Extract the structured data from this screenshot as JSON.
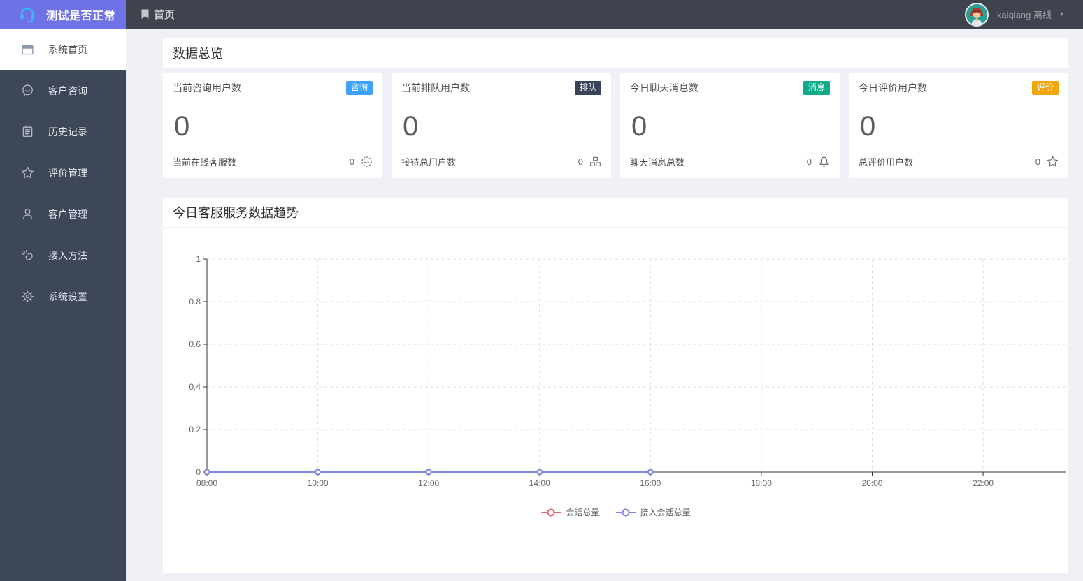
{
  "theme": {
    "logo_bg": "#6f72e6",
    "sidebar_bg": "#3e4757",
    "topbar_bg": "#3e434e",
    "headset_blue": "#3ab5f5"
  },
  "app": {
    "logo_title": "测试是否正常"
  },
  "topbar": {
    "page": "首页",
    "user": "kaiqiang 离线",
    "caret": "▾"
  },
  "sidebar": {
    "items": [
      {
        "label": "系统首页",
        "icon": "window-icon",
        "active": true
      },
      {
        "label": "客户咨询",
        "icon": "chat-smile-icon",
        "active": false
      },
      {
        "label": "历史记录",
        "icon": "history-icon",
        "active": false
      },
      {
        "label": "评价管理",
        "icon": "star-icon",
        "active": false
      },
      {
        "label": "客户管理",
        "icon": "user-icon",
        "active": false
      },
      {
        "label": "接入方法",
        "icon": "link-icon",
        "active": false
      },
      {
        "label": "系统设置",
        "icon": "gear-icon",
        "active": false
      }
    ]
  },
  "overview": {
    "title": "数据总览",
    "cards": [
      {
        "title": "当前咨询用户数",
        "badge": "咨询",
        "badge_color": "#3da2ff",
        "value": "0",
        "footer_label": "当前在线客服数",
        "footer_value": "0",
        "footer_icon": "smiley-icon"
      },
      {
        "title": "当前排队用户数",
        "badge": "排队",
        "badge_color": "#39435a",
        "value": "0",
        "footer_label": "接待总用户数",
        "footer_value": "0",
        "footer_icon": "queue-icon"
      },
      {
        "title": "今日聊天消息数",
        "badge": "消息",
        "badge_color": "#0faa8a",
        "value": "0",
        "footer_label": "聊天消息总数",
        "footer_value": "0",
        "footer_icon": "bell-icon"
      },
      {
        "title": "今日评价用户数",
        "badge": "评价",
        "badge_color": "#f2a60a",
        "value": "0",
        "footer_label": "总评价用户数",
        "footer_value": "0",
        "footer_icon": "star-icon"
      }
    ]
  },
  "trend": {
    "title": "今日客服服务数据趋势"
  },
  "chart_data": {
    "type": "line",
    "title": "今日客服服务数据趋势",
    "x_ticks": [
      "08:00",
      "10:00",
      "12:00",
      "14:00",
      "16:00",
      "18:00",
      "20:00",
      "22:00"
    ],
    "xlim_hours": [
      8,
      23.5
    ],
    "y_ticks": [
      0,
      0.2,
      0.4,
      0.6,
      0.8,
      1
    ],
    "ylim": [
      0,
      1
    ],
    "grid": true,
    "legend_position": "bottom-center",
    "series": [
      {
        "name": "会话总量",
        "color": "#e8696b",
        "x": [
          "08:00",
          "10:00",
          "12:00",
          "14:00",
          "16:00"
        ],
        "values": [
          0,
          0,
          0,
          0,
          0
        ]
      },
      {
        "name": "接入会话总量",
        "color": "#8185e2",
        "x": [
          "08:00",
          "10:00",
          "12:00",
          "14:00",
          "16:00"
        ],
        "values": [
          0,
          0,
          0,
          0,
          0
        ]
      }
    ]
  }
}
